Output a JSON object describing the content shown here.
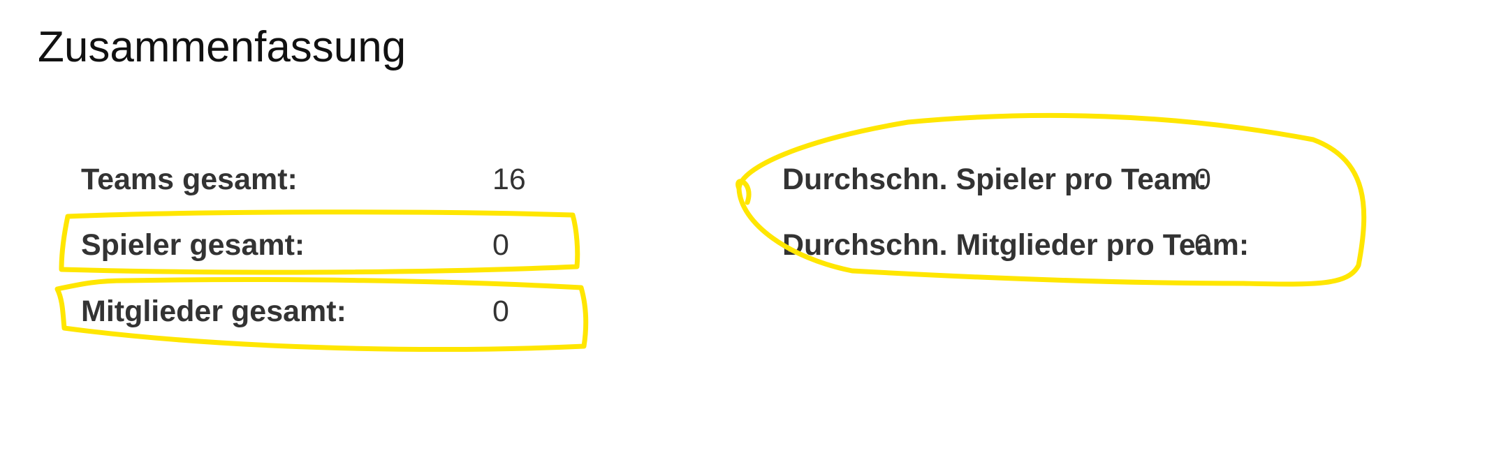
{
  "title": "Zusammenfassung",
  "stats_left": [
    {
      "label": "Teams gesamt:",
      "value": "16"
    },
    {
      "label": "Spieler gesamt:",
      "value": "0"
    },
    {
      "label": "Mitglieder gesamt:",
      "value": "0"
    }
  ],
  "stats_right": [
    {
      "label": "Durchschn. Spieler pro Team:",
      "value": "0"
    },
    {
      "label": "Durchschn. Mitglieder pro Team:",
      "value": "0"
    }
  ],
  "colors": {
    "highlight": "#FFE600",
    "text": "#333333",
    "title": "#111111"
  }
}
